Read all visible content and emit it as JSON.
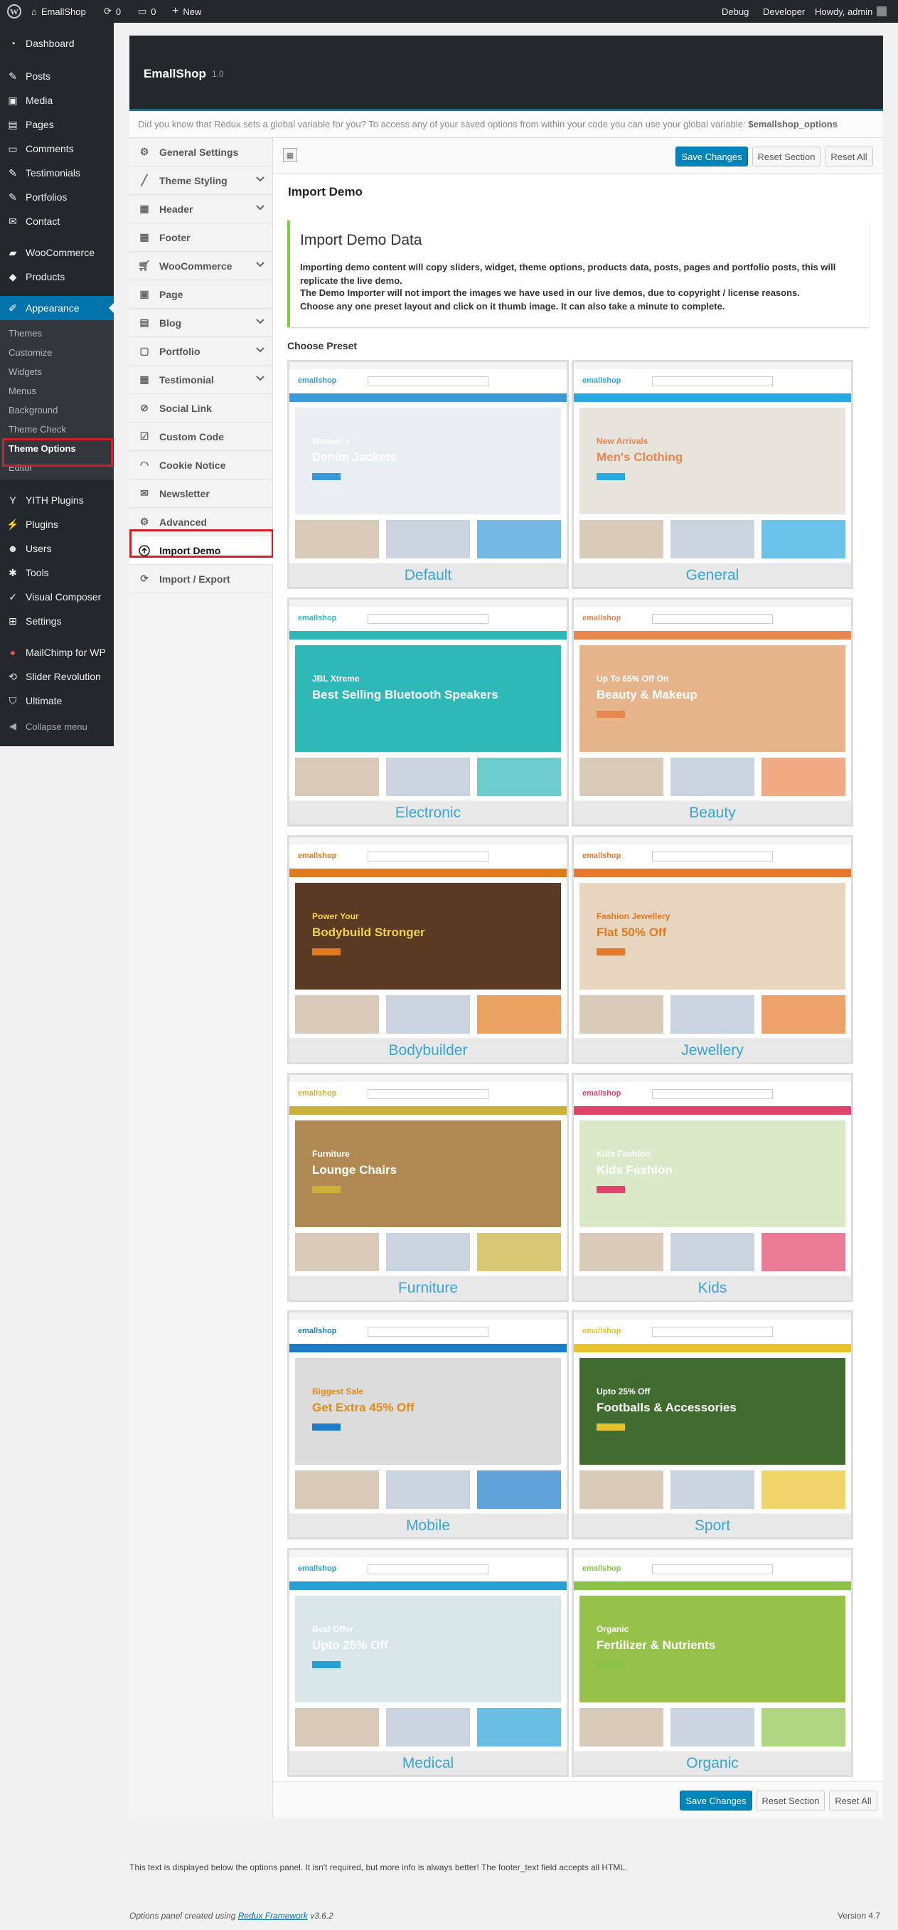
{
  "admin_bar": {
    "site": "EmallShop",
    "updates": "0",
    "comments": "0",
    "new": "New",
    "debug": "Debug",
    "developer": "Developer",
    "howdy": "Howdy, admin"
  },
  "admin_menu": {
    "items": [
      "Dashboard",
      "Posts",
      "Media",
      "Pages",
      "Comments",
      "Testimonials",
      "Portfolios",
      "Contact",
      "WooCommerce",
      "Products",
      "Appearance",
      "YITH Plugins",
      "Plugins",
      "Users",
      "Tools",
      "Visual Composer",
      "Settings",
      "MailChimp for WP",
      "Slider Revolution",
      "Ultimate",
      "Collapse menu"
    ],
    "appearance_sub": [
      "Themes",
      "Customize",
      "Widgets",
      "Menus",
      "Background",
      "Theme Check",
      "Theme Options",
      "Editor"
    ]
  },
  "panel": {
    "title": "EmallShop",
    "version": "1.0",
    "notice_prefix": "Did you know that Redux sets a global variable for you? To access any of your saved options from within your code you can use your global variable: ",
    "notice_var": "$emallshop_options",
    "save": "Save Changes",
    "reset_section": "Reset Section",
    "reset_all": "Reset All"
  },
  "sections": [
    "General Settings",
    "Theme Styling",
    "Header",
    "Footer",
    "WooCommerce",
    "Page",
    "Blog",
    "Portfolio",
    "Testimonial",
    "Social Link",
    "Custom Code",
    "Cookie Notice",
    "Newsletter",
    "Advanced",
    "Import Demo",
    "Import / Export"
  ],
  "import": {
    "heading": "Import Demo",
    "box_title": "Import Demo Data",
    "desc1": "Importing demo content will copy sliders, widget, theme options, products data, posts, pages and portfolio posts, this will replicate the live demo.",
    "desc2": "The Demo Importer will not import the images we have used in our live demos, due to copyright / license reasons.",
    "desc3": "Choose any one preset layout and click on it thumb image. It can also take a minute to complete.",
    "choose": "Choose Preset"
  },
  "presets": [
    {
      "name": "Default",
      "hero": [
        "Women's",
        "Denim Jackets"
      ],
      "accent": "#3a9ad9"
    },
    {
      "name": "General",
      "hero": [
        "New Arrivals",
        "Men's Clothing"
      ],
      "accent": "#29a9e1"
    },
    {
      "name": "Electronic",
      "hero": [
        "JBL Xtreme",
        "Best Selling Bluetooth Speakers"
      ],
      "accent": "#2fb6b6"
    },
    {
      "name": "Beauty",
      "hero": [
        "Up To 65% Off On",
        "Beauty & Makeup"
      ],
      "accent": "#e8874f"
    },
    {
      "name": "Bodybuilder",
      "hero": [
        "Power Your",
        "Bodybuild Stronger"
      ],
      "accent": "#e07a1f"
    },
    {
      "name": "Jewellery",
      "hero": [
        "Fashion Jewellery",
        "Flat 50% Off"
      ],
      "accent": "#e57a2e"
    },
    {
      "name": "Furniture",
      "hero": [
        "Furniture",
        "Lounge Chairs"
      ],
      "accent": "#c9b13a"
    },
    {
      "name": "Kids",
      "hero": [
        "Kids Fashion",
        "Kids Fashion"
      ],
      "accent": "#e0436b"
    },
    {
      "name": "Mobile",
      "hero": [
        "Biggest Sale",
        "Get Extra 45% Off"
      ],
      "accent": "#1e7cc7"
    },
    {
      "name": "Sport",
      "hero": [
        "Upto 25% Off",
        "Footballs & Accessories"
      ],
      "accent": "#e8c22a"
    },
    {
      "name": "Medical",
      "hero": [
        "Best Offer",
        "Upto 25% Off"
      ],
      "accent": "#2a9fd6"
    },
    {
      "name": "Organic",
      "hero": [
        "Organic",
        "Fertilizer & Nutrients"
      ],
      "accent": "#8bc34a"
    }
  ],
  "footer": {
    "text": "This text is displayed below the options panel. It isn't required, but more info is always better! The footer_text field accepts all HTML.",
    "credit_prefix": "Options panel created using ",
    "credit_link": "Redux Framework",
    "credit_version": " v3.6.2",
    "wp_version": "Version 4.7"
  }
}
